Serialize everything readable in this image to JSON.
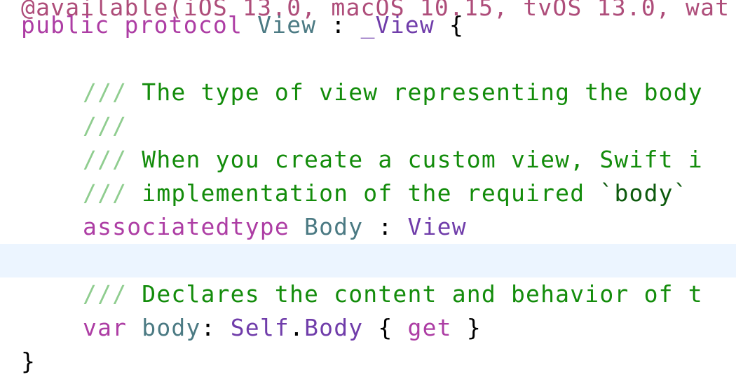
{
  "editor": {
    "lines": {
      "attr_partial": "@available(iOS 13.0, macOS 10.15, tvOS 13.0, wat",
      "protocol_kw1": "public",
      "protocol_kw2": "protocol",
      "protocol_name": "View",
      "protocol_colon": " : ",
      "protocol_super": "_View",
      "protocol_brace": " {",
      "doc1_slashes": "///",
      "doc1_text": " The type of view representing the body",
      "doc2_slashes": "///",
      "doc3_slashes": "///",
      "doc3_text": " When you create a custom view, Swift i",
      "doc4_slashes": "///",
      "doc4_text": " implementation of the required ",
      "doc4_code": "`body`",
      "assoc_kw": "associatedtype",
      "assoc_name": "Body",
      "assoc_colon": " : ",
      "assoc_type": "View",
      "doc5_slashes": "///",
      "doc5_text": " Declares the content and behavior of t",
      "var_kw": "var",
      "var_name": "body",
      "var_colon": ": ",
      "var_self": "Self",
      "var_dot": ".",
      "var_type": "Body",
      "var_open": " { ",
      "var_get": "get",
      "var_close": " }",
      "closing_brace": "}"
    }
  },
  "colors": {
    "keyword": "#ad3da4",
    "type_decl": "#4b7a83",
    "type_ref": "#703daa",
    "comment_slashes": "#8fcd8f",
    "comment_text": "#138c0b",
    "current_line_highlight": "#ecf5ff"
  }
}
